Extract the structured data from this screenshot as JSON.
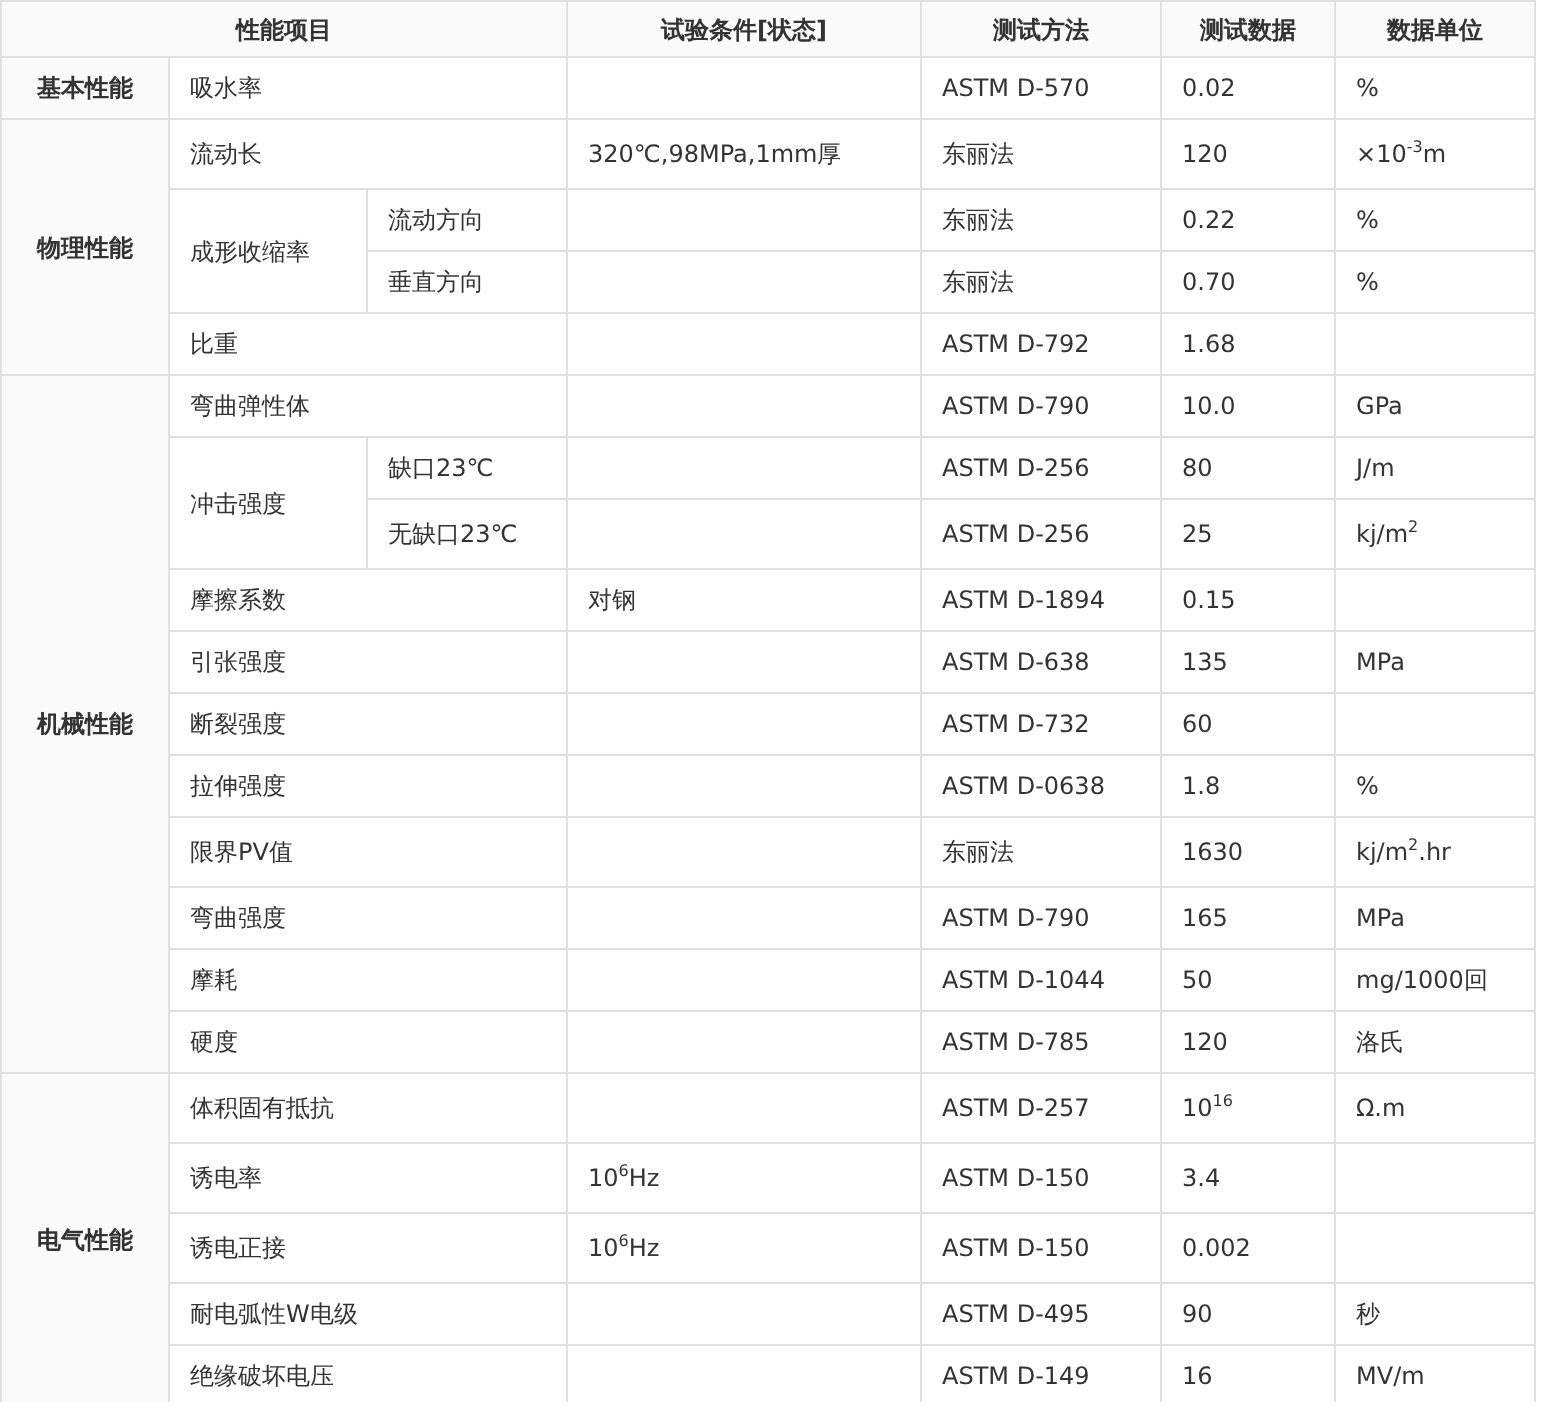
{
  "table": {
    "columns": [
      "性能项目",
      "试验条件[状态]",
      "测试方法",
      "测试数据",
      "数据单位"
    ],
    "sections": [
      {
        "name": "基本性能",
        "rows": [
          {
            "item": "吸水率",
            "method": "ASTM D-570",
            "value": "0.02",
            "unit": "%"
          }
        ]
      },
      {
        "name": "物理性能",
        "rows": [
          {
            "item": "流动长",
            "condition": "320℃,98MPa,1mm厚",
            "method": "东丽法",
            "value": "120",
            "unit": "×10$^{-3}$m"
          },
          {
            "item": "成形收缩率",
            "subitems": [
              {
                "label": "流动方向",
                "method": "东丽法",
                "value": "0.22",
                "unit": "%"
              },
              {
                "label": "垂直方向",
                "method": "东丽法",
                "value": "0.70",
                "unit": "%"
              }
            ]
          },
          {
            "item": "比重",
            "method": "ASTM D-792",
            "value": "1.68"
          }
        ]
      },
      {
        "name": "机械性能",
        "rows": [
          {
            "item": "弯曲弹性体",
            "method": "ASTM D-790",
            "value": "10.0",
            "unit": "GPa"
          },
          {
            "item": "冲击强度",
            "subitems": [
              {
                "label": "缺口23℃",
                "method": "ASTM D-256",
                "value": "80",
                "unit": "J/m"
              },
              {
                "label": "无缺口23℃",
                "method": "ASTM D-256",
                "value": "25",
                "unit": "kj/m$^{2}$"
              }
            ]
          },
          {
            "item": "摩擦系数",
            "condition": "对钢",
            "method": "ASTM D-1894",
            "value": "0.15"
          },
          {
            "item": "引张强度",
            "method": "ASTM D-638",
            "value": "135",
            "unit": "MPa"
          },
          {
            "item": "断裂强度",
            "method": "ASTM D-732",
            "value": "60"
          },
          {
            "item": "拉伸强度",
            "method": "ASTM D-0638",
            "value": "1.8",
            "unit": "%"
          },
          {
            "item": "限界PV值",
            "method": "东丽法",
            "value": "1630",
            "unit": "kj/m$^{2}$.hr"
          },
          {
            "item": "弯曲强度",
            "method": "ASTM D-790",
            "value": "165",
            "unit": "MPa"
          },
          {
            "item": "摩耗",
            "method": "ASTM D-1044",
            "value": "50",
            "unit": "mg/1000回"
          },
          {
            "item": "硬度",
            "method": "ASTM D-785",
            "value": "120",
            "unit": "洛氏"
          }
        ]
      },
      {
        "name": "电气性能",
        "rows": [
          {
            "item": "体积固有抵抗",
            "method": "ASTM D-257",
            "value": "10$^{16}$",
            "unit": "Ω.m"
          },
          {
            "item": "诱电率",
            "condition": "10$^{6}$Hz",
            "method": "ASTM D-150",
            "value": "3.4"
          },
          {
            "item": "诱电正接",
            "condition": "10$^{6}$Hz",
            "method": "ASTM D-150",
            "value": "0.002"
          },
          {
            "item": "耐电弧性W电级",
            "method": "ASTM D-495",
            "value": "90",
            "unit": "秒"
          },
          {
            "item": "绝缘破坏电压",
            "method": "ASTM D-149",
            "value": "16",
            "unit": "MV/m"
          }
        ]
      }
    ]
  }
}
